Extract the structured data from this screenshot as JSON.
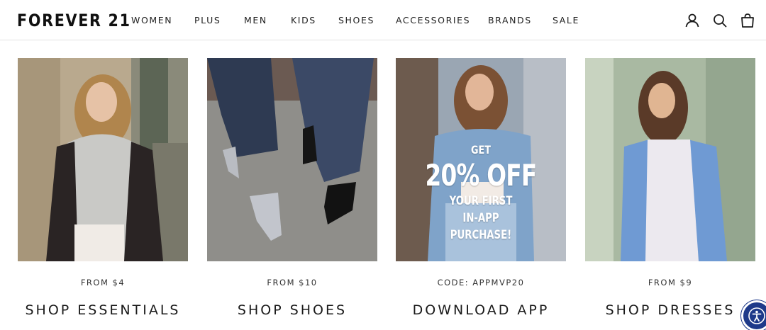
{
  "brand": {
    "logo_text": "FOREVER 21"
  },
  "nav": {
    "items": [
      "WOMEN",
      "PLUS",
      "MEN",
      "KIDS",
      "SHOES",
      "ACCESSORIES",
      "BRANDS",
      "SALE"
    ]
  },
  "header_icons": [
    "account-icon",
    "search-icon",
    "shopping-bag-icon"
  ],
  "cards": [
    {
      "subtitle": "FROM $4",
      "title": "SHOP ESSENTIALS"
    },
    {
      "subtitle": "FROM $10",
      "title": "SHOP SHOES"
    },
    {
      "subtitle": "CODE: APPMVP20",
      "title": "DOWNLOAD APP",
      "promo": {
        "line1": "GET",
        "line2": "20% OFF",
        "line3": "YOUR FIRST",
        "line4": "IN-APP",
        "line5": "PURCHASE!"
      }
    },
    {
      "subtitle": "FROM $9",
      "title": "SHOP DRESSES"
    }
  ],
  "colors": {
    "accessibility_button": "#1e3a8a",
    "text": "#1a1a1a",
    "divider": "#e2e2e2"
  },
  "accessibility_widget": {
    "icon": "accessibility-icon"
  }
}
